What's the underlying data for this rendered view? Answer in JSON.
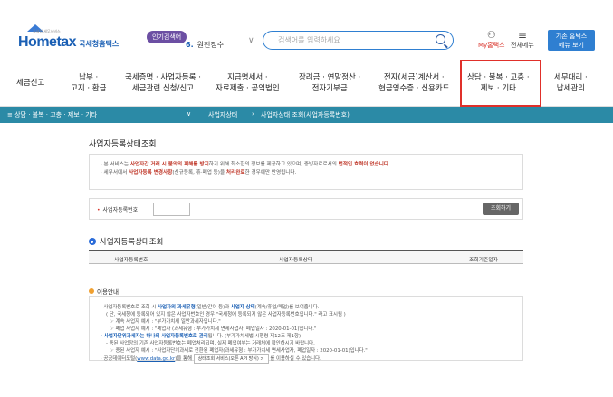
{
  "header": {
    "logo": "Hometax",
    "logo_sub": "국세청홈택스",
    "logo_tiny": "국세청 세무서비스",
    "popular_badge": "인기검색어",
    "popular_rank": "6.",
    "popular_term": "원천징수",
    "search_placeholder": "검색어를 입력하세요",
    "myhome": "My홈택스",
    "allmenu": "전체메뉴",
    "basic_btn_1": "기존 홈택스",
    "basic_btn_2": "메뉴 보기"
  },
  "gnb": [
    {
      "l1": "세금신고",
      "l2": ""
    },
    {
      "l1": "납부 ·",
      "l2": "고지 · 환급"
    },
    {
      "l1": "국세증명 · 사업자등록 ·",
      "l2": "세금관련 신청/신고"
    },
    {
      "l1": "지급명세서 ·",
      "l2": "자료제출 · 공익법인"
    },
    {
      "l1": "장려금 · 연말정산 ·",
      "l2": "전자기부금"
    },
    {
      "l1": "전자(세금)계산서 ·",
      "l2": "현금영수증 · 신용카드"
    },
    {
      "l1": "상담 · 불복 · 고충 ·",
      "l2": "제보 · 기타"
    },
    {
      "l1": "세무대리 ·",
      "l2": "납세관리"
    }
  ],
  "breadcrumb": {
    "menu": "≡  상담 · 불복 · 고충 · 제보 · 기타",
    "chev": "∨",
    "step1": "사업자상태",
    "step2": "사업자상태 조회(사업자등록번호)"
  },
  "page": {
    "title": "사업자등록상태조회",
    "notice_1a": "· 본 서비스는 ",
    "notice_1b": "사업자간 거래 시 불의의 피해를 방지",
    "notice_1c": "하기 위해 최소한의 정보를 제공하고 있으며, 증빙자료로서의 ",
    "notice_1d": "법적인 효력이 없습니다.",
    "notice_2a": "· 세무서에서 ",
    "notice_2b": "사업자등록 변경사항",
    "notice_2c": "(신규등록, 휴·폐업 등)을 ",
    "notice_2d": "처리완료",
    "notice_2e": "한 경우에만 반영됩니다.",
    "form_label": "사업자등록번호",
    "lookup_btn": "조회하기",
    "section_title": "사업자등록상태조회",
    "th_1": "사업자등록번호",
    "th_2": "사업자등록상태",
    "th_3": "조회기준일자",
    "guide_title": "이용안내",
    "g1a": "· 사업자등록번호로 조회 시 ",
    "g1b": "사업자의 과세유형",
    "g1c": "(일반/간이 등)과 ",
    "g1d": "사업자 상태",
    "g1e": "(계속/휴업/폐업)를 보여줍니다.",
    "g2": "( 단, 국세청에 등록되어 있지 않은 사업자번호인 경우 \"국세청에 등록되지 않은 사업자등록번호입니다.\" 라고 표시됨 )",
    "g3": "☞ 계속 사업자 예시 : \"부가가치세 일반과세자입니다.\"",
    "g4": "☞ 폐업 사업자 예시 : \"폐업자 (과세유형 : 부가가치세 면세사업자, 폐업일자 : 2020-01-01)입니다.\"",
    "g5a": "· 사업자단위과세자는 하나의 사업자등록번호로 관리",
    "g5b": "됩니다. (부가가치세법 시행령 제12조 제1항)",
    "g6": "- 종된 사업장의 기존 사업자등록번호는 폐업처리되며, 실제 폐업여부는 거래처에 확인하시기 바랍니다.",
    "g7": "☞ 종된 사업자 예시 : \"사업자단위과세로 전환된 폐업자(과세유형 : 부가가치세 면세사업자, 폐업일자 : 2020-01-01)입니다.\"",
    "g8a": "· 공공데이터포털(",
    "g8b": "www.data.go.kr",
    "g8c": ")을 통해 ",
    "g8d": "상태조회 서비스(오픈 API 방식) >",
    "g8e": " 를 이용하실 수 있습니다."
  },
  "colors": {
    "brand": "#1a5fb4",
    "teal": "#2b8aa6",
    "highlight": "#e0302a"
  }
}
